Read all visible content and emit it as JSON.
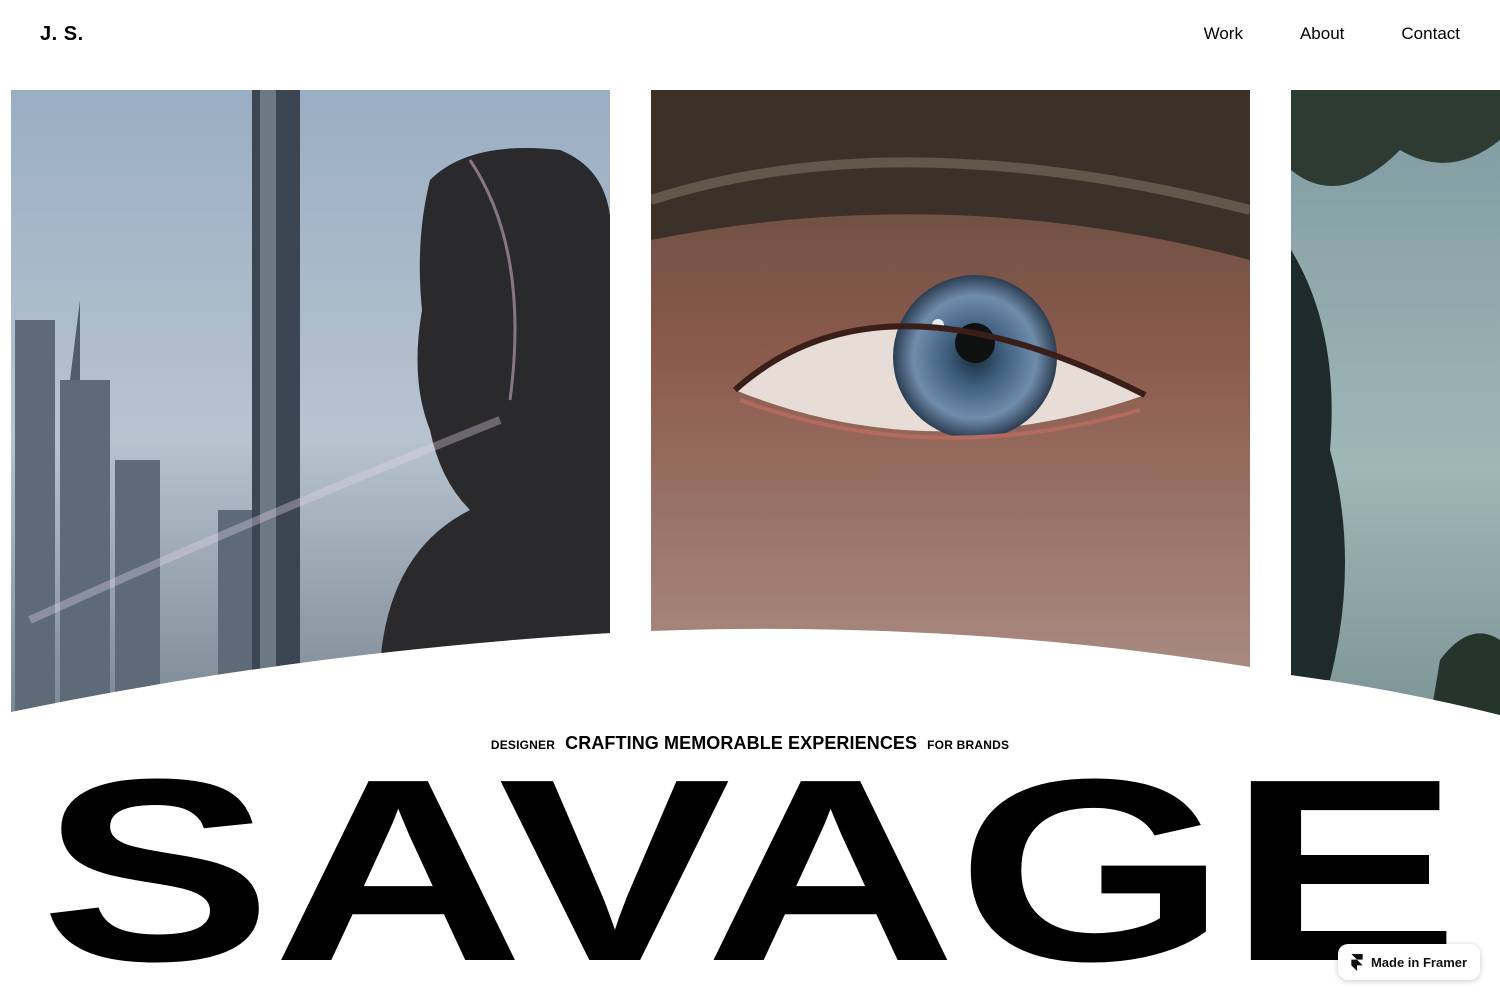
{
  "header": {
    "logo": "J. S.",
    "nav": [
      "Work",
      "About",
      "Contact"
    ]
  },
  "gallery": {
    "images": [
      {
        "alt": "woman-silhouette-city-window-image"
      },
      {
        "alt": "close-up-eye-image"
      },
      {
        "alt": "figure-under-pine-trees-image"
      }
    ]
  },
  "tagline": {
    "role": "DESIGNER",
    "statement": "CRAFTING MEMORABLE EXPERIENCES",
    "audience": "FOR BRANDS"
  },
  "hero": {
    "word": "SAVAGE"
  },
  "badge": {
    "label": "Made in Framer",
    "icon": "framer-logo-icon"
  }
}
